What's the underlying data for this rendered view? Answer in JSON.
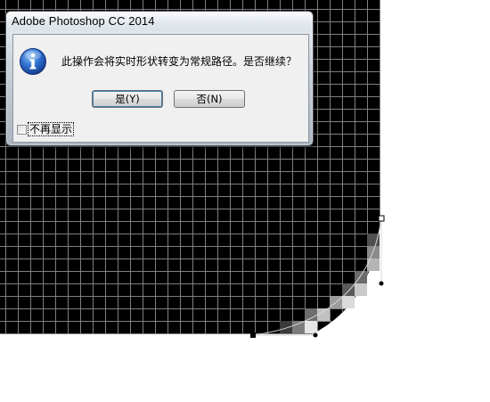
{
  "dialog": {
    "title": "Adobe Photoshop CC 2014",
    "icon": "info-icon",
    "message": "此操作会将实时形状转变为常规路径。是否继续？",
    "buttons": {
      "yes_label": "是(Y)",
      "no_label": "否(N)"
    },
    "checkbox": {
      "label": "不再显示",
      "checked": false
    }
  },
  "canvas": {
    "background_color": "#000000",
    "grid_color": "#7f7f7f",
    "page_color": "#ffffff",
    "path_color": "#d8d8d8",
    "anchor_color": "#000000"
  }
}
